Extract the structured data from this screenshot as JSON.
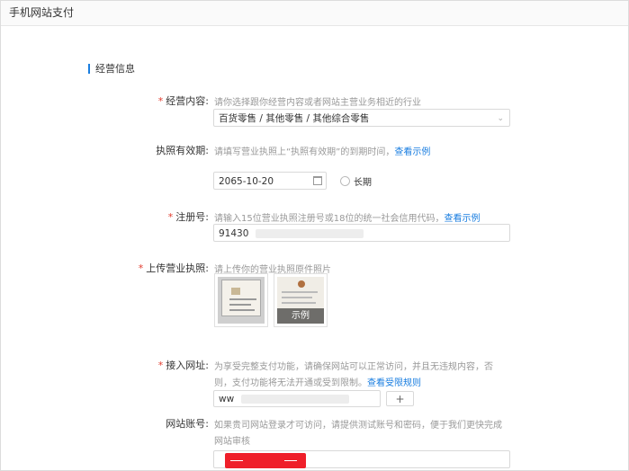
{
  "window": {
    "title": "手机网站支付"
  },
  "section": {
    "title": "经营信息"
  },
  "business_scope": {
    "label": "经营内容:",
    "hint": "请你选择跟你经营内容或者网站主营业务相近的行业",
    "value": "百货零售 / 其他零售 / 其他综合零售"
  },
  "license_validity": {
    "label": "执照有效期:",
    "hint": "请填写营业执照上“执照有效期”的到期时间，",
    "link": "查看示例",
    "date_value": "2065-10-20",
    "longterm_label": "长期"
  },
  "registration": {
    "label": "注册号:",
    "hint": "请输入15位营业执照注册号或18位的统一社会信用代码，",
    "link": "查看示例",
    "value": "91430"
  },
  "upload_license": {
    "label": "上传营业执照:",
    "hint": "请上传你的营业执照原件照片",
    "sample_label": "示例"
  },
  "website_url": {
    "label": "接入网址:",
    "hint_line1": "为享受完整支付功能，请确保网站可以正常访问，并且无违规内容，否",
    "hint_line2": "则，支付功能将无法开通或受到限制。",
    "link": "查看受限规则",
    "value": "ww",
    "add_label": "+"
  },
  "site_account": {
    "label": "网站账号:",
    "hint_line1": "如果贵司网站登录才可访问，请提供测试账号和密码，便于我们更快完成",
    "hint_line2": "网站审核"
  },
  "colors": {
    "accent": "#1a7ee0",
    "required": "#e23b2e",
    "redaction": "#ef1f2a"
  }
}
